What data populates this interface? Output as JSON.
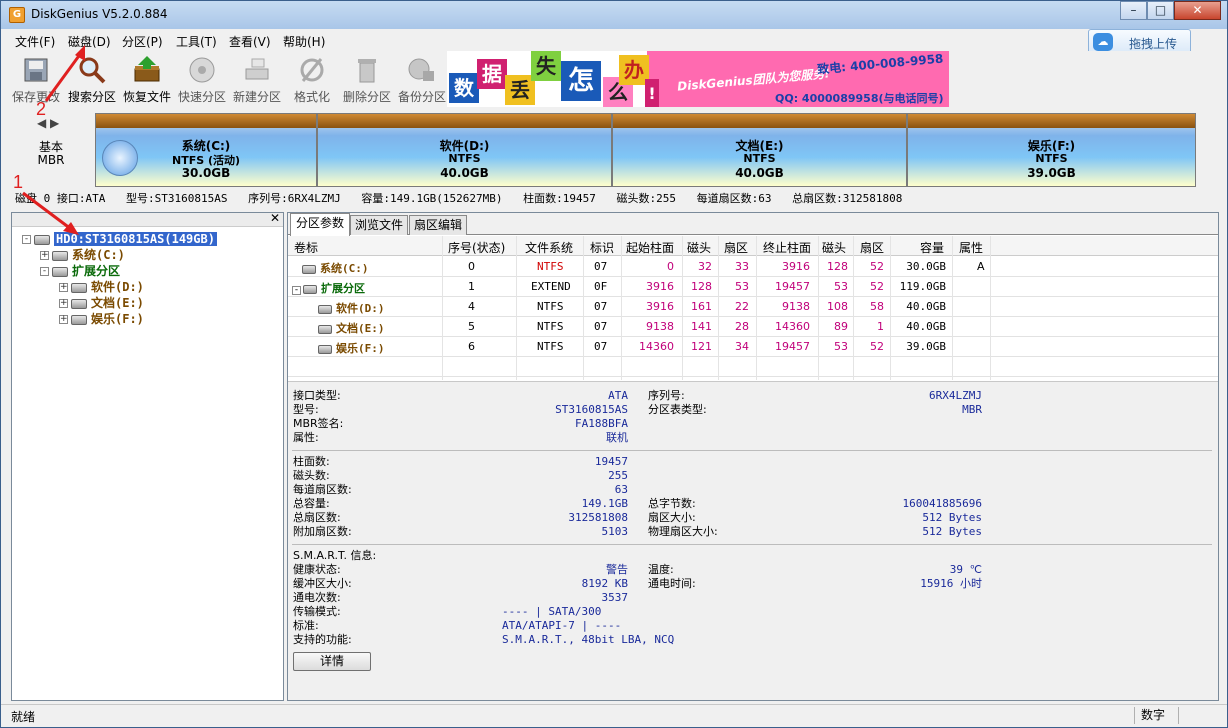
{
  "window": {
    "title": "DiskGenius V5.2.0.884",
    "app_icon": "G"
  },
  "menu": [
    "文件(F)",
    "磁盘(D)",
    "分区(P)",
    "工具(T)",
    "查看(V)",
    "帮助(H)"
  ],
  "cloud_button": "拖拽上传",
  "toolbar": [
    {
      "label": "保存更改",
      "icon": "save-icon",
      "enabled": false
    },
    {
      "label": "搜索分区",
      "icon": "search-partition-icon",
      "enabled": true
    },
    {
      "label": "恢复文件",
      "icon": "recover-files-icon",
      "enabled": true
    },
    {
      "label": "快速分区",
      "icon": "quick-partition-icon",
      "enabled": false
    },
    {
      "label": "新建分区",
      "icon": "new-partition-icon",
      "enabled": false
    },
    {
      "label": "格式化",
      "icon": "format-icon",
      "enabled": false
    },
    {
      "label": "删除分区",
      "icon": "delete-partition-icon",
      "enabled": false
    },
    {
      "label": "备份分区",
      "icon": "backup-partition-icon",
      "enabled": false
    }
  ],
  "banner": {
    "tiles": [
      "数",
      "据",
      "丢",
      "失",
      "怎",
      "么",
      "办",
      "!"
    ],
    "slogan": "DiskGenius团队为您服务!",
    "phone": "致电: 400-008-9958",
    "qq": "QQ: 4000089958(与电话同号)"
  },
  "disk_label": {
    "line1": "基本",
    "line2": "MBR"
  },
  "partitions_bar": [
    {
      "name": "系统(C:)",
      "fs": "NTFS (活动)",
      "size": "30.0GB"
    },
    {
      "name": "软件(D:)",
      "fs": "NTFS",
      "size": "40.0GB"
    },
    {
      "name": "文档(E:)",
      "fs": "NTFS",
      "size": "40.0GB"
    },
    {
      "name": "娱乐(F:)",
      "fs": "NTFS",
      "size": "39.0GB"
    }
  ],
  "disk_info": [
    "磁盘 0 接口:ATA",
    "型号:ST3160815AS",
    "序列号:6RX4LZMJ",
    "容量:149.1GB(152627MB)",
    "柱面数:19457",
    "磁头数:255",
    "每道扇区数:63",
    "总扇区数:312581808"
  ],
  "tree": [
    {
      "label": "HD0:ST3160815AS(149GB)",
      "level": 0,
      "expander": "-",
      "selected": true
    },
    {
      "label": "系统(C:)",
      "level": 1,
      "expander": "+"
    },
    {
      "label": "扩展分区",
      "level": 1,
      "expander": "-",
      "extended": true
    },
    {
      "label": "软件(D:)",
      "level": 2,
      "expander": "+"
    },
    {
      "label": "文档(E:)",
      "level": 2,
      "expander": "+"
    },
    {
      "label": "娱乐(F:)",
      "level": 2,
      "expander": "+"
    }
  ],
  "tabs": [
    "分区参数",
    "浏览文件",
    "扇区编辑"
  ],
  "table": {
    "headers": [
      "卷标",
      "序号(状态)",
      "文件系统",
      "标识",
      "起始柱面",
      "磁头",
      "扇区",
      "终止柱面",
      "磁头",
      "扇区",
      "容量",
      "属性"
    ],
    "rows": [
      {
        "label": "系统(C:)",
        "seq": "0",
        "fs": "NTFS",
        "id": "07",
        "sc": "0",
        "sh": "32",
        "ss": "33",
        "ec": "3916",
        "eh": "128",
        "es": "52",
        "cap": "30.0GB",
        "attr": "A",
        "indent": 1
      },
      {
        "label": "扩展分区",
        "seq": "1",
        "fs": "EXTEND",
        "id": "0F",
        "sc": "3916",
        "sh": "128",
        "ss": "53",
        "ec": "19457",
        "eh": "53",
        "es": "52",
        "cap": "119.0GB",
        "attr": "",
        "indent": 0,
        "extended": true
      },
      {
        "label": "软件(D:)",
        "seq": "4",
        "fs": "NTFS",
        "id": "07",
        "sc": "3916",
        "sh": "161",
        "ss": "22",
        "ec": "9138",
        "eh": "108",
        "es": "58",
        "cap": "40.0GB",
        "attr": "",
        "indent": 2
      },
      {
        "label": "文档(E:)",
        "seq": "5",
        "fs": "NTFS",
        "id": "07",
        "sc": "9138",
        "sh": "141",
        "ss": "28",
        "ec": "14360",
        "eh": "89",
        "es": "1",
        "cap": "40.0GB",
        "attr": "",
        "indent": 2
      },
      {
        "label": "娱乐(F:)",
        "seq": "6",
        "fs": "NTFS",
        "id": "07",
        "sc": "14360",
        "sh": "121",
        "ss": "34",
        "ec": "19457",
        "eh": "53",
        "es": "52",
        "cap": "39.0GB",
        "attr": "",
        "indent": 2
      }
    ]
  },
  "info": {
    "interface_label": "接口类型:",
    "interface": "ATA",
    "model_label": "型号:",
    "model": "ST3160815AS",
    "mbr_label": "MBR签名:",
    "mbr": "FA188BFA",
    "attr_label": "属性:",
    "attr": "联机",
    "serial_label": "序列号:",
    "serial": "6RX4LZMJ",
    "pt_label": "分区表类型:",
    "pt": "MBR",
    "cyl_label": "柱面数:",
    "cyl": "19457",
    "heads_label": "磁头数:",
    "heads": "255",
    "spt_label": "每道扇区数:",
    "spt": "63",
    "cap_label": "总容量:",
    "cap": "149.1GB",
    "totsec_label": "总扇区数:",
    "totsec": "312581808",
    "addsec_label": "附加扇区数:",
    "addsec": "5103",
    "bytes_label": "总字节数:",
    "bytes": "160041885696",
    "secsize_label": "扇区大小:",
    "secsize": "512 Bytes",
    "physec_label": "物理扇区大小:",
    "physec": "512 Bytes",
    "smart_label": "S.M.A.R.T. 信息:",
    "health_label": "健康状态:",
    "health": "警告",
    "buffer_label": "缓冲区大小:",
    "buffer": "8192 KB",
    "poweron_label": "通电次数:",
    "poweron": "3537",
    "temp_label": "温度:",
    "temp": "39 ℃",
    "hours_label": "通电时间:",
    "hours": "15916 小时",
    "mode_label": "传输模式:",
    "mode": "---- | SATA/300",
    "std_label": "标准:",
    "std": "ATA/ATAPI-7 | ----",
    "feat_label": "支持的功能:",
    "feat": "S.M.A.R.T., 48bit LBA, NCQ",
    "details_button": "详情"
  },
  "status": {
    "text": "就绪",
    "num": "数字"
  },
  "annotations": [
    "1",
    "2"
  ]
}
